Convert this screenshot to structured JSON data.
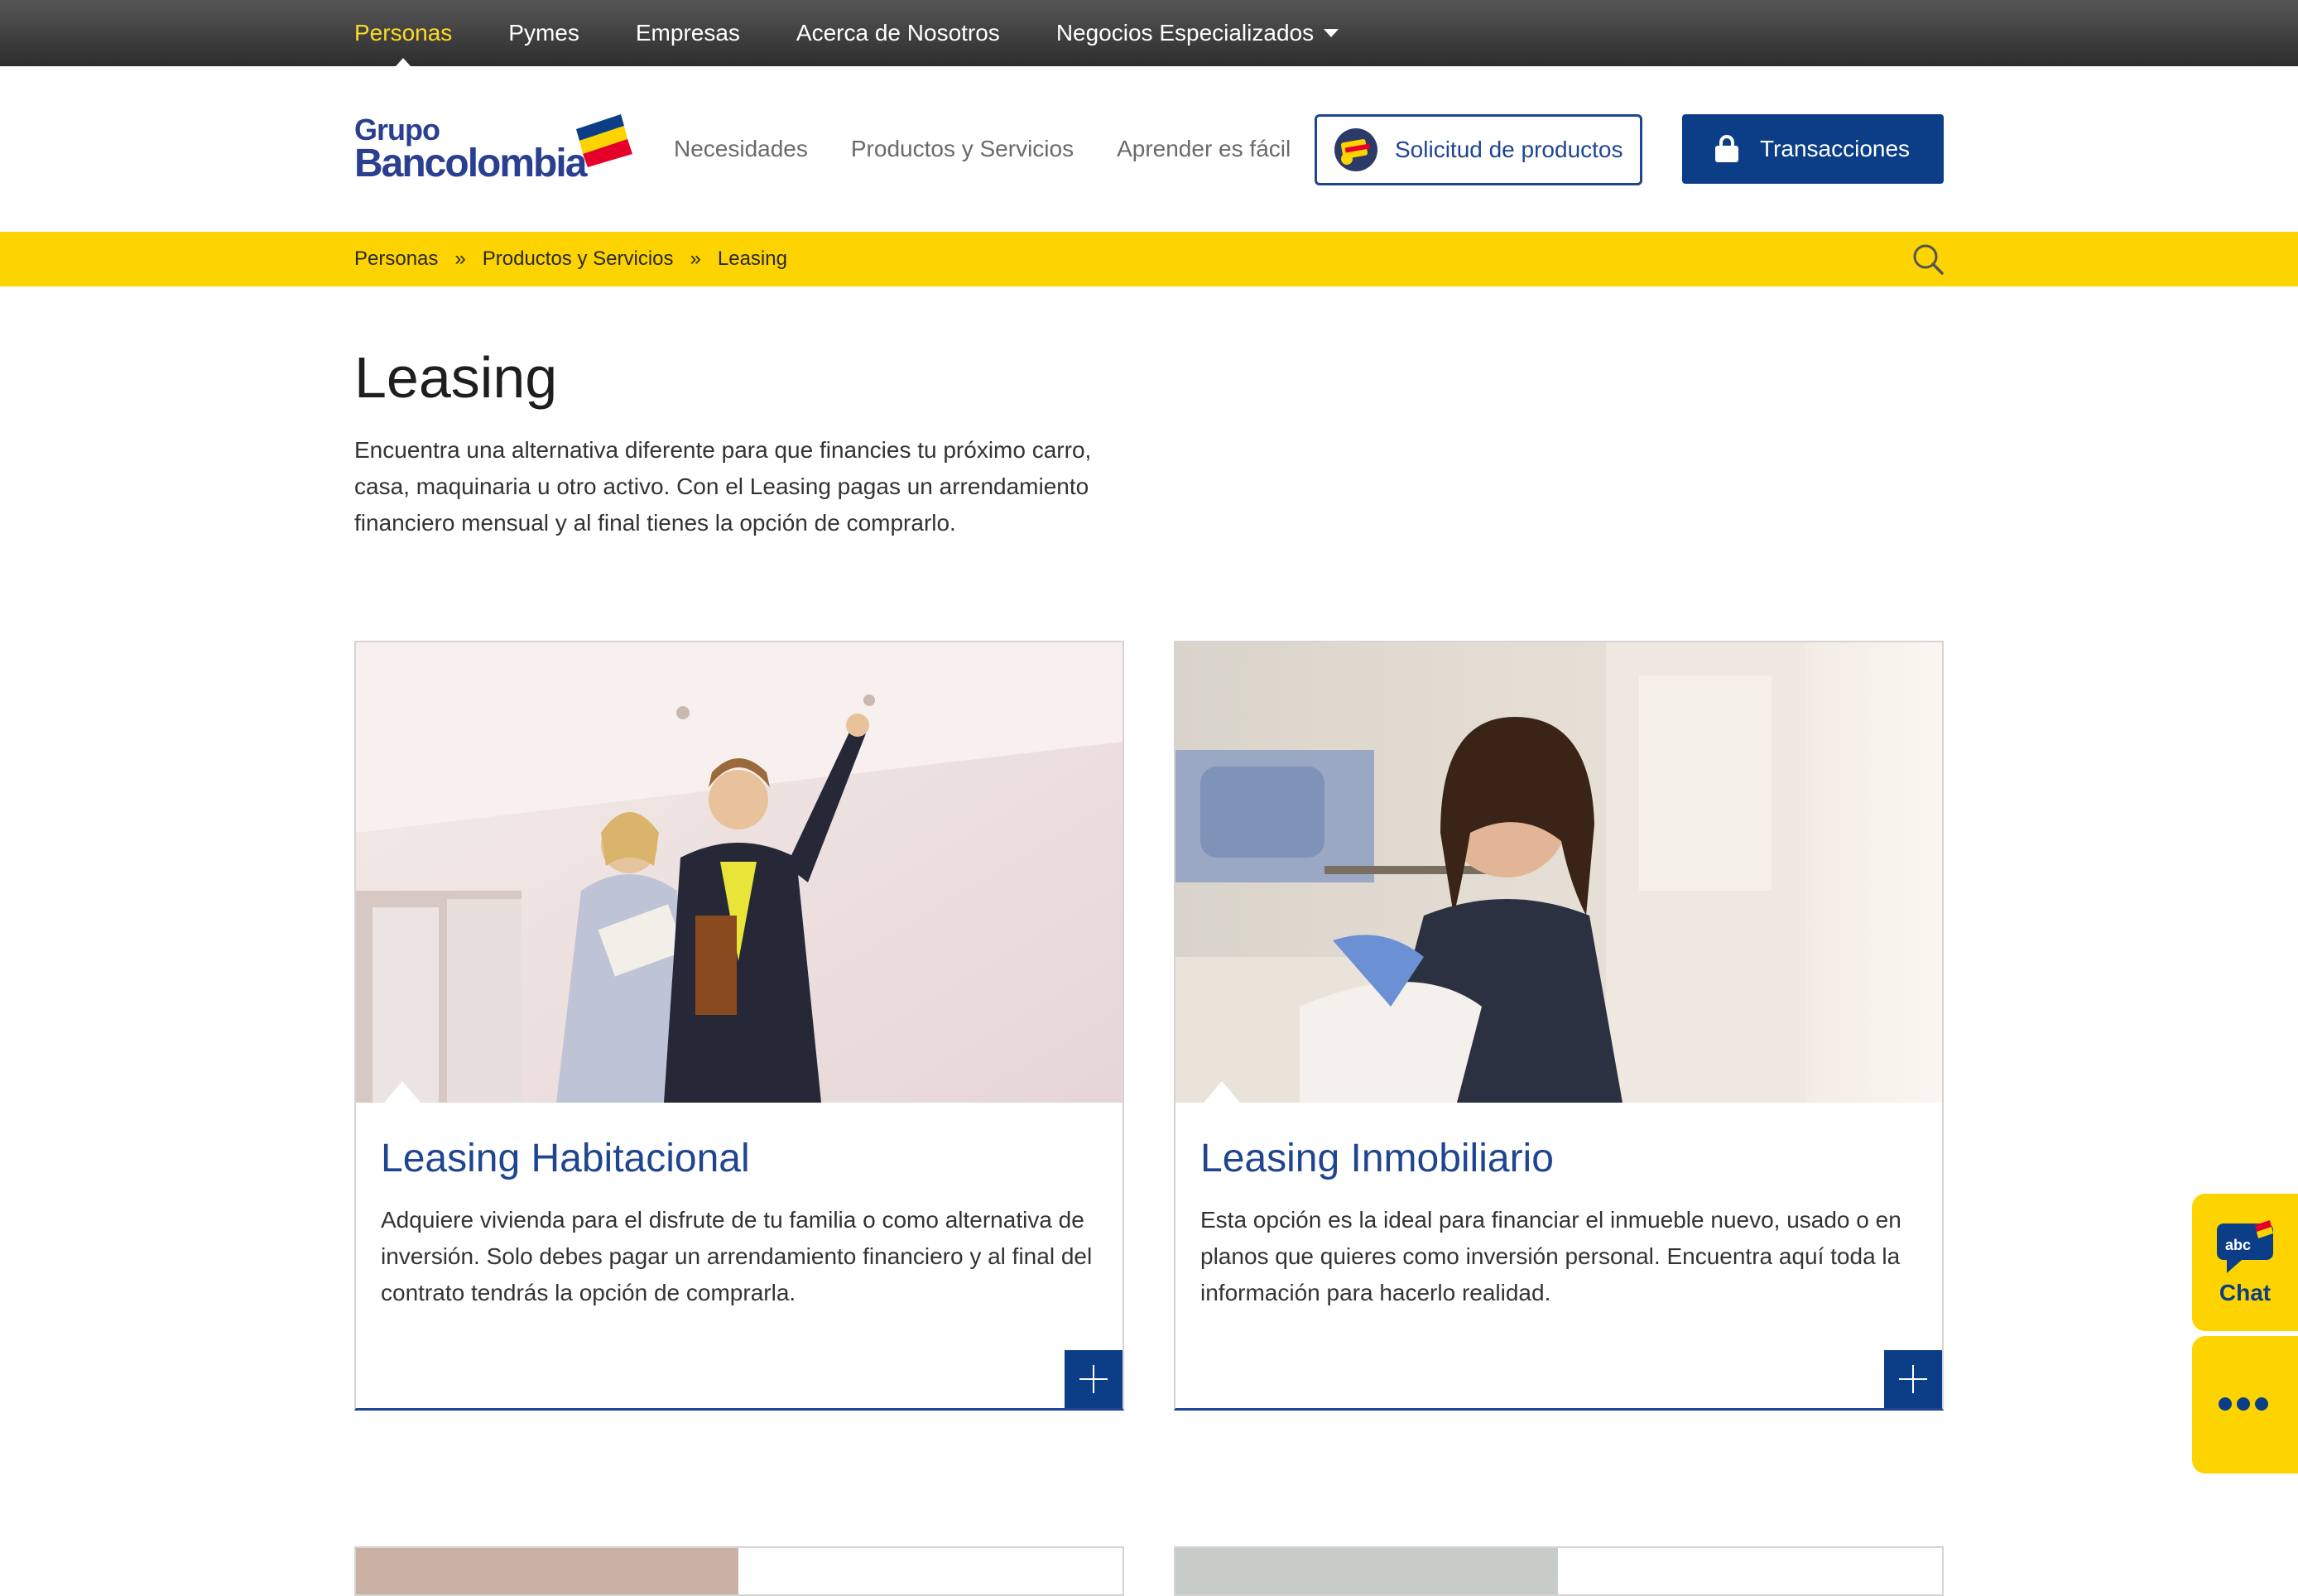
{
  "top_nav": {
    "items": [
      {
        "label": "Personas",
        "active": true
      },
      {
        "label": "Pymes",
        "active": false
      },
      {
        "label": "Empresas",
        "active": false
      },
      {
        "label": "Acerca de Nosotros",
        "active": false
      },
      {
        "label": "Negocios Especializados",
        "active": false
      }
    ]
  },
  "logo": {
    "line1": "Grupo",
    "line2": "Bancolombia"
  },
  "main_nav": {
    "items": [
      "Necesidades",
      "Productos y Servicios",
      "Aprender es fácil"
    ]
  },
  "buttons": {
    "solicitud": "Solicitud de productos",
    "transacciones": "Transacciones"
  },
  "breadcrumb": {
    "items": [
      "Personas",
      "Productos y Servicios",
      "Leasing"
    ],
    "separator": "»"
  },
  "page": {
    "title": "Leasing",
    "intro": "Encuentra una alternativa diferente para que financies tu próximo carro, casa, maquinaria u otro activo. Con el Leasing pagas un arrendamiento financiero mensual y al final tienes la opción de comprarlo."
  },
  "cards": [
    {
      "title": "Leasing Habitacional",
      "description": "Adquiere vivienda para el disfrute de tu familia o como alternativa de inversión. Solo debes pagar un arrendamiento financiero y al final del contrato tendrás la opción de comprarla."
    },
    {
      "title": "Leasing Inmobiliario",
      "description": "Esta opción es la ideal para financiar el inmueble nuevo, usado o en planos que quieres como inversión personal. Encuentra aquí toda la información para hacerlo realidad."
    }
  ],
  "widgets": {
    "chat_label": "Chat",
    "chat_badge": "abc"
  },
  "colors": {
    "brand_blue": "#0c3e87",
    "brand_yellow": "#fdd300",
    "active_nav": "#fdda24",
    "brand_red": "#e4002b"
  }
}
